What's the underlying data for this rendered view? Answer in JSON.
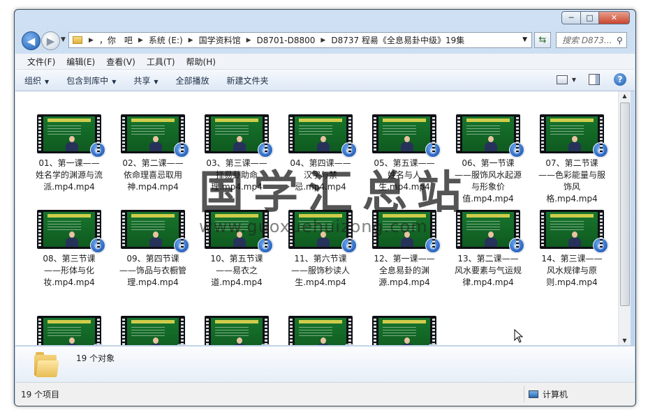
{
  "window": {
    "buttons": {
      "minimize": "─",
      "maximize": "□",
      "close": "✕"
    }
  },
  "address": {
    "crumbs": [
      "，你　吧",
      "系统 (E:)",
      "国学资料馆",
      "D8701-D8800",
      "D8737 程昜《全息易卦中级》19集"
    ],
    "search_placeholder": "搜索 D873..."
  },
  "menu": [
    "文件(F)",
    "编辑(E)",
    "查看(V)",
    "工具(T)",
    "帮助(H)"
  ],
  "toolbar": {
    "organize": "组织",
    "include_library": "包含到库中",
    "share": "共享",
    "play_all": "全部播放",
    "new_folder": "新建文件夹"
  },
  "files": [
    {
      "name": "01、第一课——姓名学的渊源与流派.mp4.mp4"
    },
    {
      "name": "02、第二课——依命理喜忌取用神.mp4.mp4"
    },
    {
      "name": "03、第三课——择易卦助命理.mp4.mp4"
    },
    {
      "name": "04、第四课——汉字与禁忌.mp4.mp4"
    },
    {
      "name": "05、第五课——姓名与人生.mp4.mp4"
    },
    {
      "name": "06、第一节课——服饰风水起源与形象价值.mp4.mp4"
    },
    {
      "name": "07、第二节课——色彩能量与服饰风格.mp4.mp4"
    },
    {
      "name": "08、第三节课——形体与化妆.mp4.mp4"
    },
    {
      "name": "09、第四节课——饰品与衣橱管理.mp4.mp4"
    },
    {
      "name": "10、第五节课——易衣之道.mp4.mp4"
    },
    {
      "name": "11、第六节课——服饰秒读人生.mp4.mp4"
    },
    {
      "name": "12、第一课——全息易卦的渊源.mp4.mp4"
    },
    {
      "name": "13、第二课——风水要素与气运规律.mp4.mp4"
    },
    {
      "name": "14、第三课——风水规律与原则.mp4.mp4"
    },
    {
      "name": ""
    },
    {
      "name": ""
    },
    {
      "name": ""
    },
    {
      "name": ""
    },
    {
      "name": ""
    }
  ],
  "detail": {
    "count": "19 个对象"
  },
  "status": {
    "items": "19 个项目",
    "location": "计算机"
  },
  "watermark": {
    "main": "国学汇总站",
    "url": "www.guoxuehuizong.com"
  },
  "colors": {
    "accent": "#1d5fb3",
    "slide_green": "#17752c",
    "slide_title": "#e3d64f"
  }
}
